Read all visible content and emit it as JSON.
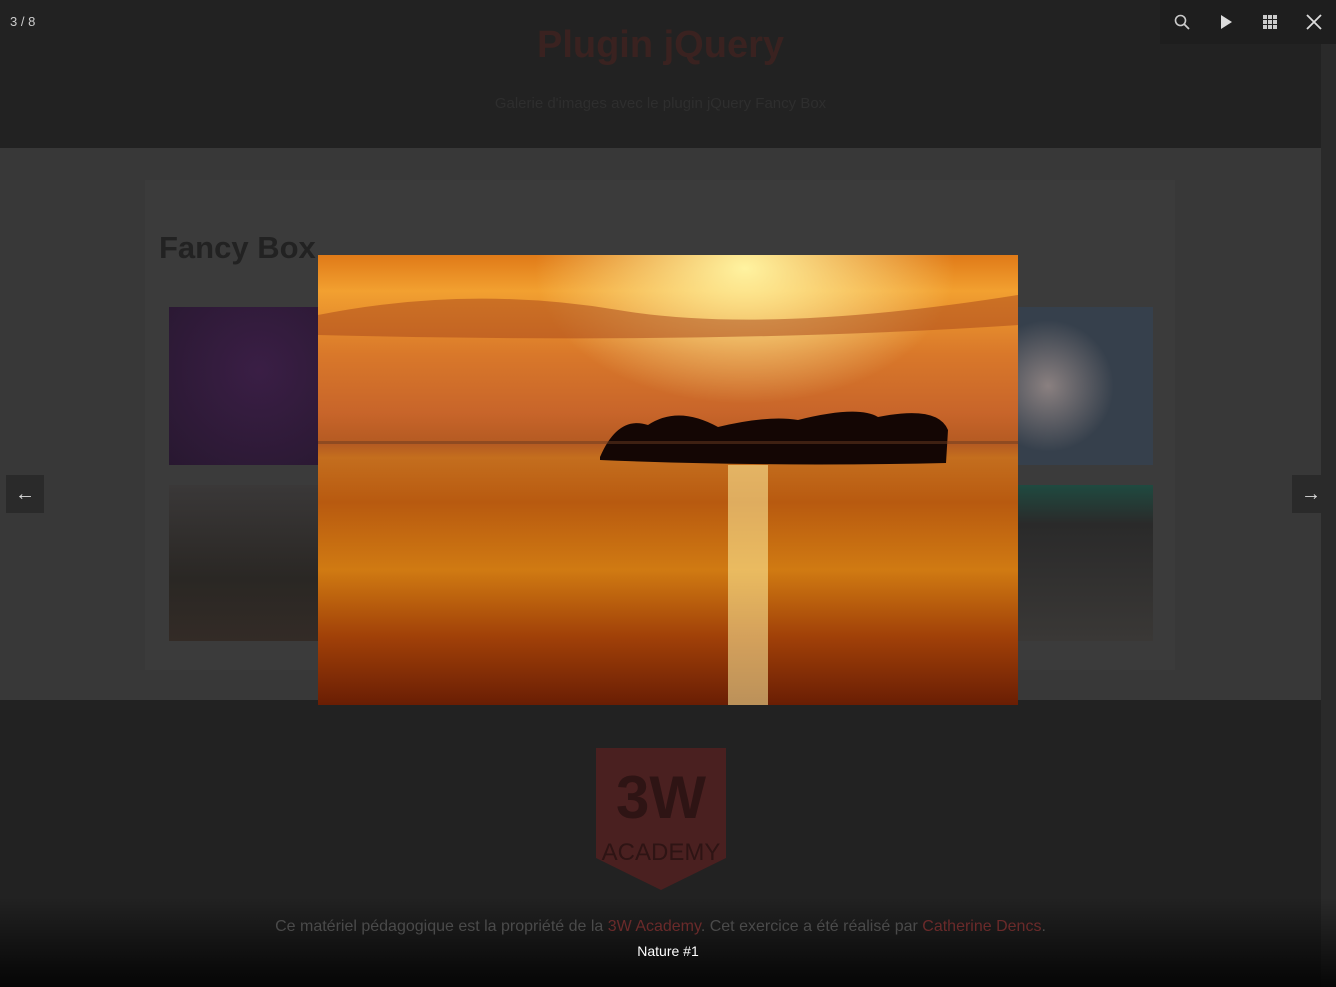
{
  "page": {
    "title": "Plugin jQuery",
    "subtitle": "Galerie d'images avec le plugin jQuery Fancy Box",
    "section_title": "Fancy Box",
    "footer": {
      "logo_text": "3W ACADEMY",
      "credit_prefix": "Ce matériel pédagogique est la propriété de la ",
      "credit_link1": "3W Academy",
      "credit_middle": ". Cet exercice a été réalisé par ",
      "credit_link2": "Catherine Dencs",
      "credit_suffix": "."
    }
  },
  "lightbox": {
    "counter": "3 / 8",
    "caption": "Nature #1",
    "toolbar": [
      {
        "name": "zoom",
        "icon": "search-icon"
      },
      {
        "name": "slideshow",
        "icon": "play-icon"
      },
      {
        "name": "thumbnails",
        "icon": "grid-icon"
      },
      {
        "name": "close",
        "icon": "close-icon"
      }
    ],
    "prev_icon": "←",
    "next_icon": "→"
  }
}
